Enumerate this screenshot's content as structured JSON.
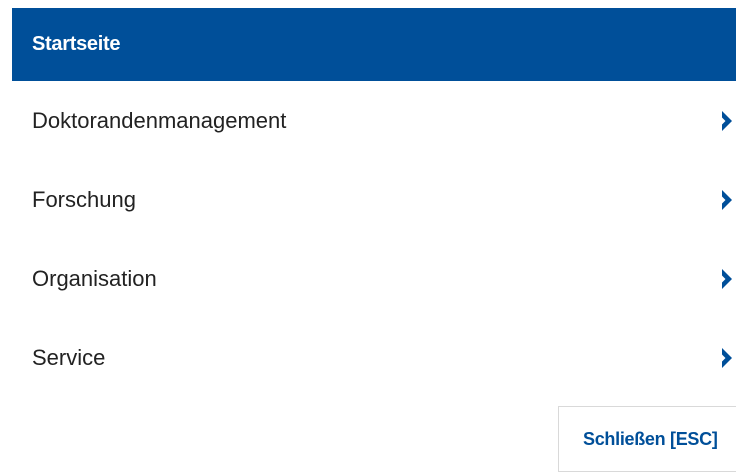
{
  "menu": {
    "header": {
      "label": "Startseite"
    },
    "items": [
      {
        "label": "Doktorandenmanagement",
        "icon": "chevron-right-icon"
      },
      {
        "label": "Forschung",
        "icon": "chevron-right-icon"
      },
      {
        "label": "Organisation",
        "icon": "chevron-right-icon"
      },
      {
        "label": "Service",
        "icon": "chevron-right-icon"
      }
    ]
  },
  "close_button": {
    "label": "Schließen [ESC]"
  },
  "colors": {
    "brand_blue": "#004f99",
    "text": "#222222",
    "background": "#ffffff",
    "border": "#d9d9d9"
  }
}
